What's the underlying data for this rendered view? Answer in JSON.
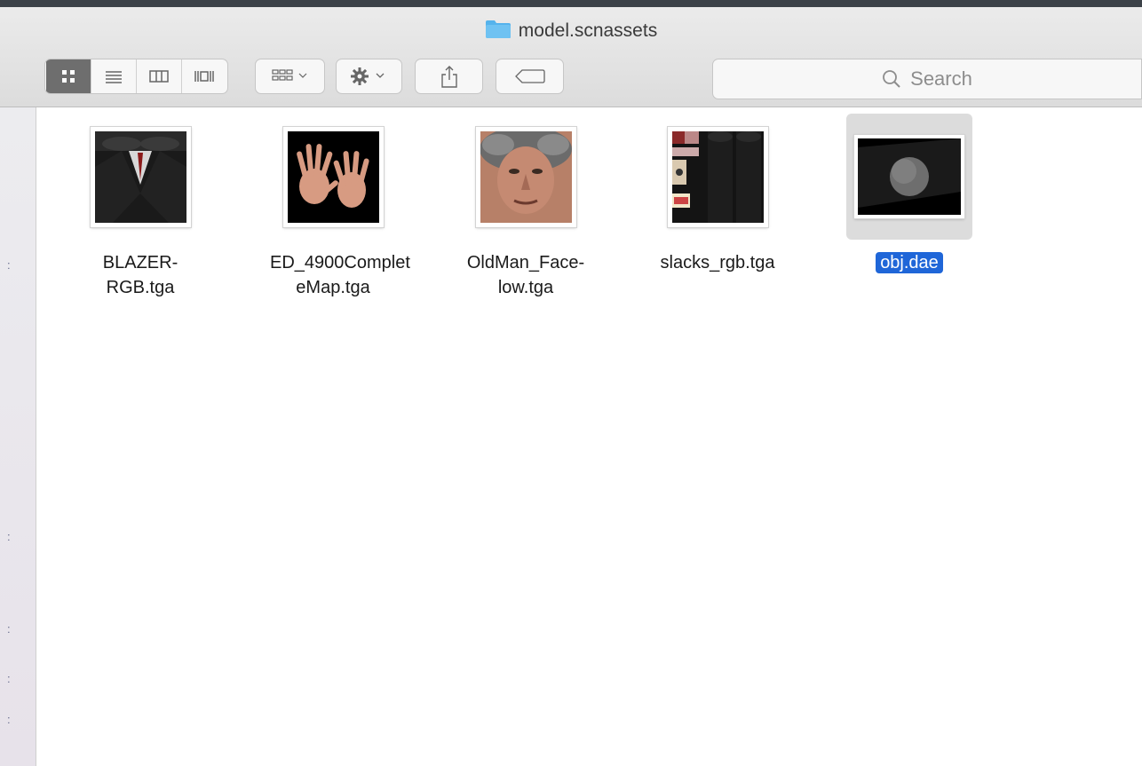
{
  "window": {
    "title": "model.scnassets"
  },
  "toolbar": {
    "view_buttons": [
      "icon-view",
      "list-view",
      "column-view",
      "cover-flow-view"
    ],
    "arrange_icon": "arrange-icon",
    "action_icon": "gear-icon",
    "share_icon": "share-icon",
    "tag_icon": "tag-icon"
  },
  "search": {
    "placeholder": "Search"
  },
  "files": [
    {
      "name": "BLAZER-RGB.tga"
    },
    {
      "name": "ED_4900Complet\neMap.tga"
    },
    {
      "name": "OldMan_Face-\nlow.tga"
    },
    {
      "name": "slacks_rgb.tga"
    },
    {
      "name": "obj.dae",
      "selected": true
    }
  ],
  "colors": {
    "selection": "#1f66d8",
    "folder": "#55b3ec"
  }
}
